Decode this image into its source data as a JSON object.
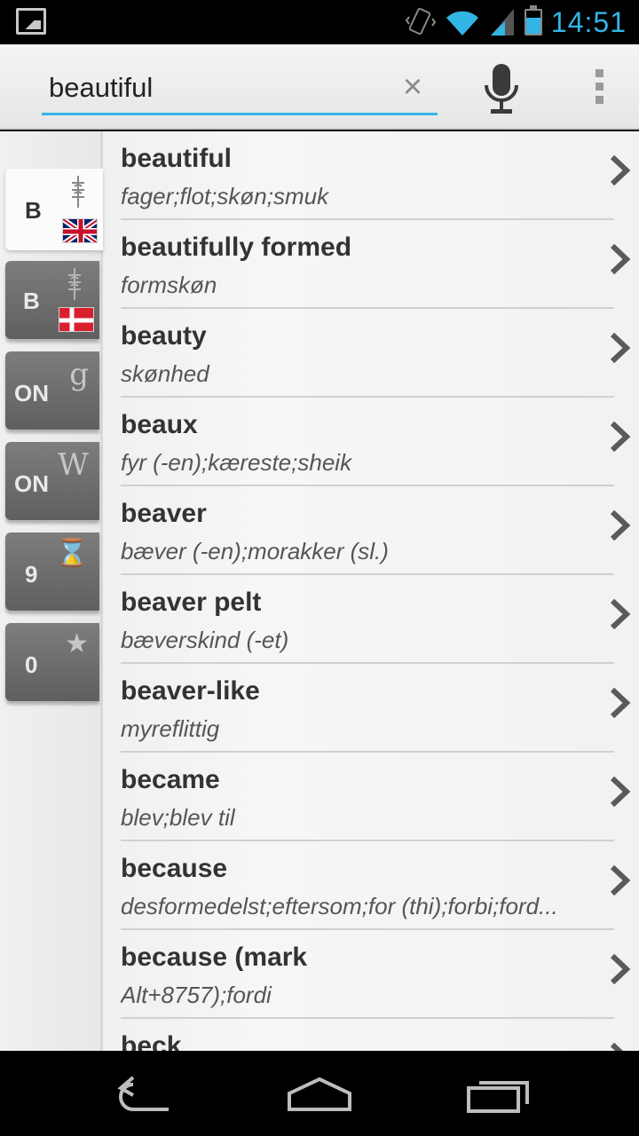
{
  "status_bar": {
    "time": "14:51",
    "icons": [
      "image-notification-icon",
      "vibrate-icon",
      "wifi-icon",
      "signal-icon",
      "battery-icon"
    ]
  },
  "search": {
    "value": "beautiful",
    "placeholder": "",
    "clear_icon": "×"
  },
  "tabs": [
    {
      "label": "B",
      "icon": "dictionary-icon",
      "flag": "uk"
    },
    {
      "label": "B",
      "icon": "dictionary-icon",
      "flag": "dk"
    },
    {
      "label": "ON",
      "icon": "google-icon",
      "glyph": "g"
    },
    {
      "label": "ON",
      "icon": "wikipedia-icon",
      "glyph": "W"
    },
    {
      "label": "9",
      "icon": "history-icon",
      "glyph": "⌛"
    },
    {
      "label": "0",
      "icon": "star-icon",
      "glyph": "★"
    }
  ],
  "results": [
    {
      "term": "beautiful",
      "translation": "fager;flot;skøn;smuk"
    },
    {
      "term": "beautifully formed",
      "translation": "formskøn"
    },
    {
      "term": "beauty",
      "translation": "skønhed"
    },
    {
      "term": "beaux",
      "translation": "fyr (-en);kæreste;sheik"
    },
    {
      "term": "beaver",
      "translation": "bæver (-en);morakker (sl.)"
    },
    {
      "term": "beaver pelt",
      "translation": "bæverskind (-et)"
    },
    {
      "term": "beaver-like",
      "translation": "myreflittig"
    },
    {
      "term": "became",
      "translation": "blev;blev til"
    },
    {
      "term": "because",
      "translation": "desformedelst;eftersom;for (thi);forbi;ford..."
    },
    {
      "term": "because (mark",
      "translation": "Alt+8757);fordi"
    },
    {
      "term": "beck",
      "translation": ""
    }
  ],
  "colors": {
    "accent": "#33b5e5",
    "tab_inactive": "#6e6e6e",
    "text_primary": "#333333",
    "text_secondary": "#555555"
  }
}
